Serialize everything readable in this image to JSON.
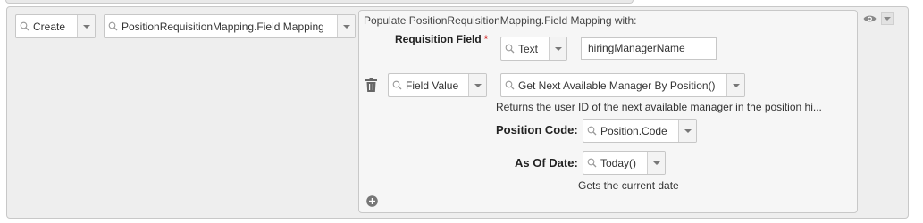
{
  "rule": {
    "action_select": {
      "value": "Create",
      "icon": "search-icon"
    },
    "target_select": {
      "value": "PositionRequisitionMapping.Field Mapping",
      "icon": "search-icon"
    }
  },
  "panel": {
    "heading": "Populate PositionRequisitionMapping.Field Mapping with:",
    "requisition_field": {
      "label": "Requisition Field",
      "required_mark": "*",
      "type_select": "Text",
      "value": "hiringManagerName"
    },
    "value_row": {
      "source_select": "Field Value",
      "function_select": "Get Next Available Manager By Position()",
      "description": "Returns the user ID of the next available manager in the position hi..."
    },
    "position_code": {
      "label": "Position Code:",
      "value": "Position.Code"
    },
    "as_of_date": {
      "label": "As Of Date:",
      "value": "Today()",
      "description": "Gets the current date"
    }
  },
  "icons": {
    "delete": "trash-icon",
    "add": "plus-circle-icon",
    "view": "eye-icon",
    "menu": "chevron-down-icon"
  },
  "colors": {
    "background": "#eeeeee",
    "panel": "#f6f6f6",
    "required": "#cc0000"
  }
}
